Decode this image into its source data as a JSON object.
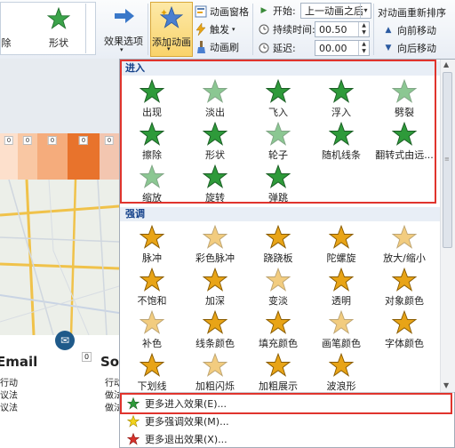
{
  "ribbon": {
    "gallery": [
      {
        "label": "除"
      },
      {
        "label": "形状"
      }
    ],
    "effect_options": "效果选项",
    "add_animation": "添加动画",
    "animation_pane": "动画窗格",
    "trigger": "触发",
    "animation_painter": "动画刷",
    "start_label": "开始:",
    "start_value": "上一动画之后",
    "duration_label": "持续时间:",
    "duration_value": "00.50",
    "delay_label": "延迟:",
    "delay_value": "00.00",
    "reorder_title": "对动画重新排序",
    "move_earlier": "向前移动",
    "move_later": "向后移动"
  },
  "slide": {
    "zeros": [
      "0",
      "0",
      "0",
      "0",
      "0"
    ],
    "small_zero": "0",
    "heading_email": "Email",
    "heading_so": "So",
    "left_lines": [
      "行动",
      "议法",
      "议法"
    ],
    "right_lines": [
      "行动",
      "做法",
      "做法"
    ],
    "colors": [
      "#fde0cc",
      "#f9c7a3",
      "#f5ac7c",
      "#e8732c",
      "#f3c6b0"
    ]
  },
  "panel": {
    "entrance": {
      "title": "进入",
      "items": [
        "出现",
        "淡出",
        "飞入",
        "浮入",
        "劈裂",
        "擦除",
        "形状",
        "轮子",
        "随机线条",
        "翻转式由远...",
        "缩放",
        "旋转",
        "弹跳"
      ]
    },
    "emphasis": {
      "title": "强调",
      "items": [
        "脉冲",
        "彩色脉冲",
        "跷跷板",
        "陀螺旋",
        "放大/缩小",
        "不饱和",
        "加深",
        "变淡",
        "透明",
        "对象颜色",
        "补色",
        "线条颜色",
        "填充颜色",
        "画笔颜色",
        "字体颜色",
        "下划线",
        "加粗闪烁",
        "加粗展示",
        "波浪形"
      ]
    },
    "more_entrance": "更多进入效果(E)...",
    "more_emphasis": "更多强调效果(M)...",
    "more_exit": "更多退出效果(X)..."
  },
  "colors": {
    "entrance_star": "#2e9a3a",
    "emphasis_star": "#e8a417",
    "highlight": "#e0342d",
    "section_text": "#15428b"
  }
}
